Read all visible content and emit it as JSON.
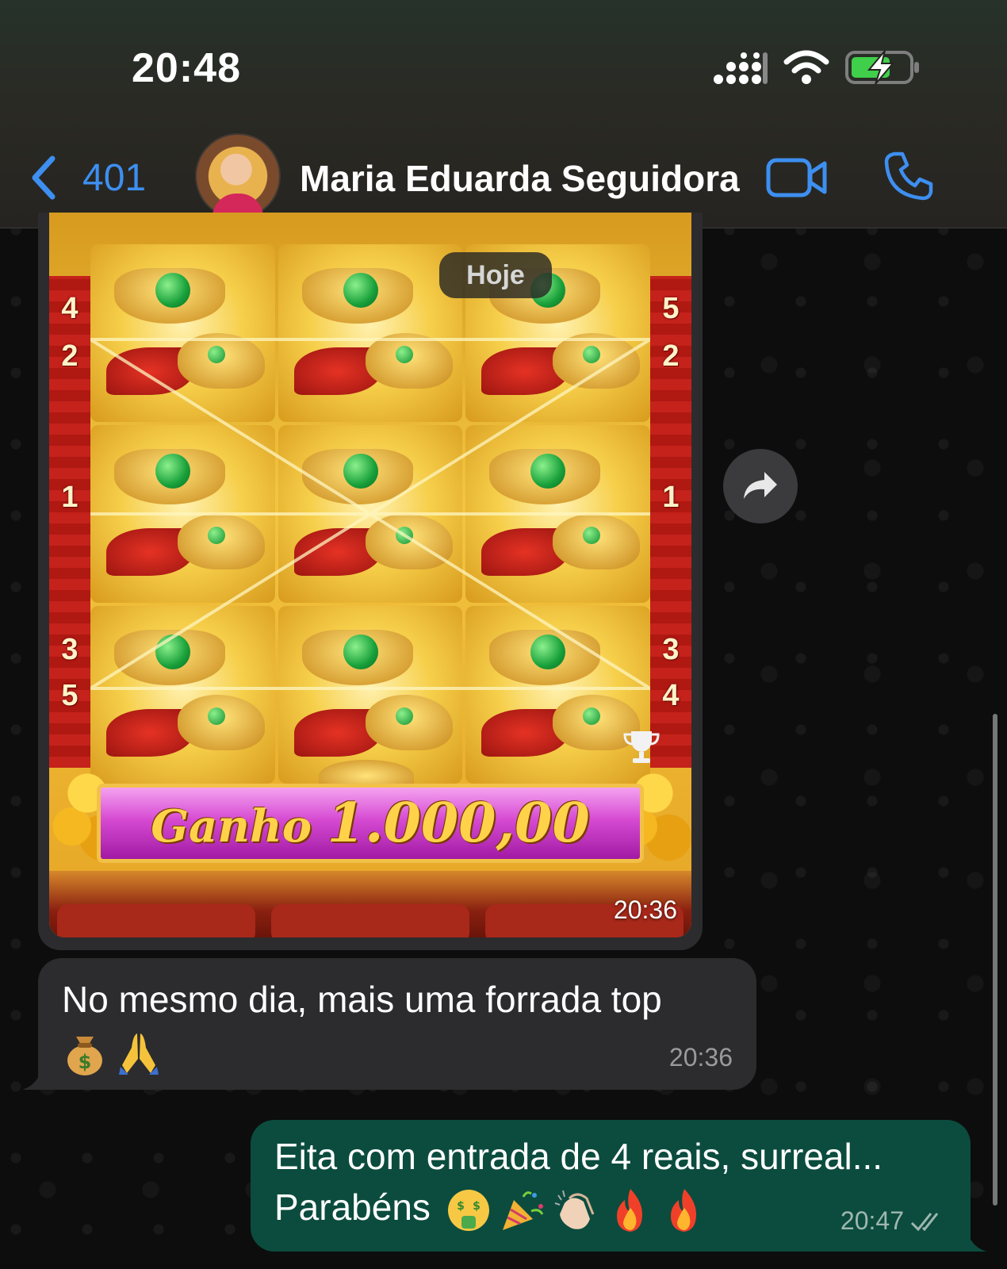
{
  "status_bar": {
    "time": "20:48"
  },
  "header": {
    "back_count": "401",
    "contact_name": "Maria Eduarda Seguidora"
  },
  "date_chip": "Hoje",
  "image_message": {
    "win_label": "Ganho",
    "win_amount": "1.000,00",
    "time": "20:36",
    "left_numbers": [
      "4",
      "2",
      "1",
      "3",
      "5"
    ],
    "right_numbers": [
      "5",
      "2",
      "1",
      "3",
      "4"
    ]
  },
  "incoming_message": {
    "text": "No mesmo dia, mais uma forrada top",
    "emojis": [
      "money-bag",
      "praying-hands"
    ],
    "time": "20:36"
  },
  "outgoing_message": {
    "line1": "Eita com entrada de 4 reais, surreal...",
    "line2": "Parabéns",
    "emojis": [
      "money-mouth-face",
      "party-popper",
      "clapping-hands",
      "fire",
      "fire"
    ],
    "time": "20:47",
    "status": "read"
  },
  "colors": {
    "accent": "#3d8ff0",
    "incoming_bubble": "#2c2c2e",
    "outgoing_bubble": "#0b4c3e"
  }
}
